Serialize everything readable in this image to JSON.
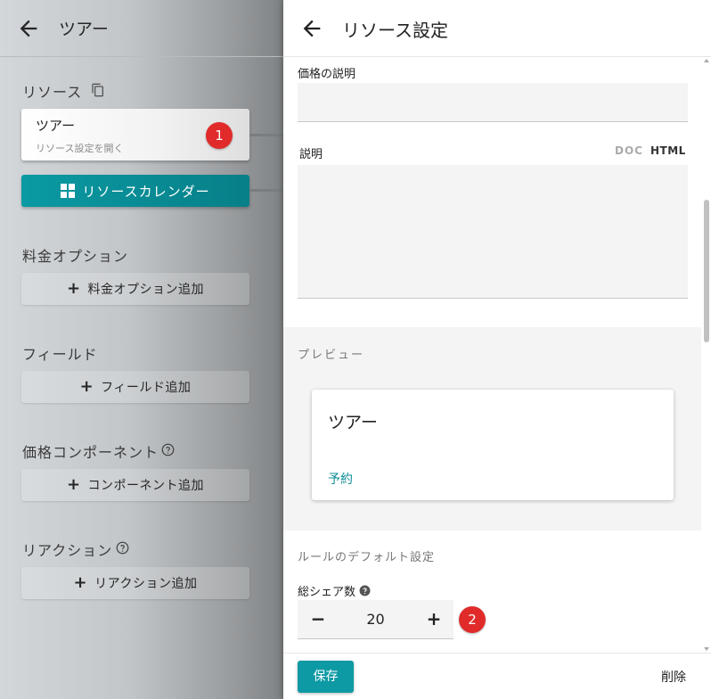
{
  "left": {
    "title": "ツアー",
    "resource_section": "リソース",
    "tour_card": {
      "title": "ツアー",
      "subtitle": "リソース設定を開く"
    },
    "badge1": "1",
    "calendar_button": "リソースカレンダー",
    "price_options": {
      "label": "料金オプション",
      "add": "料金オプション追加"
    },
    "fields": {
      "label": "フィールド",
      "add": "フィールド追加"
    },
    "price_components": {
      "label": "価格コンポーネント",
      "add": "コンポーネント追加"
    },
    "reactions": {
      "label": "リアクション",
      "add": "リアクション追加"
    }
  },
  "right": {
    "title": "リソース設定",
    "price_description_label": "価格の説明",
    "description_label": "説明",
    "format_doc": "DOC",
    "format_html": "HTML",
    "preview_label": "プレビュー",
    "preview_card": {
      "title": "ツアー",
      "reserve": "予約"
    },
    "rule_default_label": "ルールのデフォルト設定",
    "total_shares_label": "総シェア数",
    "total_shares_value": "20",
    "badge2": "2",
    "save_button": "保存",
    "delete_button": "削除"
  },
  "colors": {
    "accent": "#0e9aa4",
    "badge": "#e12b2b"
  },
  "icons": [
    "back-arrow-icon",
    "copy-icon",
    "grid-icon",
    "plus-icon",
    "help-icon",
    "minus-icon"
  ]
}
